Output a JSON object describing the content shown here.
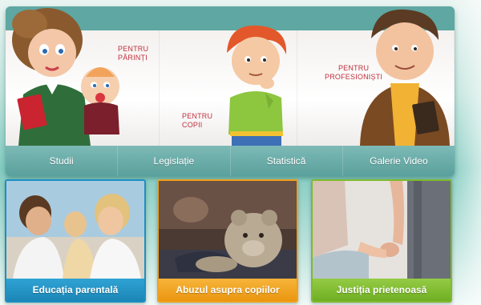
{
  "hero": {
    "panels": [
      {
        "label": "Pentru\npărinți"
      },
      {
        "label": "Pentru\ncopii"
      },
      {
        "label": "Pentru\nprofesioniști"
      }
    ]
  },
  "nav": {
    "items": [
      "Studii",
      "Legislație",
      "Statistică",
      "Galerie Video"
    ]
  },
  "cards": [
    {
      "caption": "Educația parentală",
      "accent": "#1d8fc1"
    },
    {
      "caption": "Abuzul asupra copiilor",
      "accent": "#f0a01c"
    },
    {
      "caption": "Justiția prietenoasă",
      "accent": "#7dbb2d"
    }
  ],
  "colors": {
    "label_red": "#c0303c",
    "nav_teal": "#5aa09c",
    "background": "#82cbc0"
  }
}
